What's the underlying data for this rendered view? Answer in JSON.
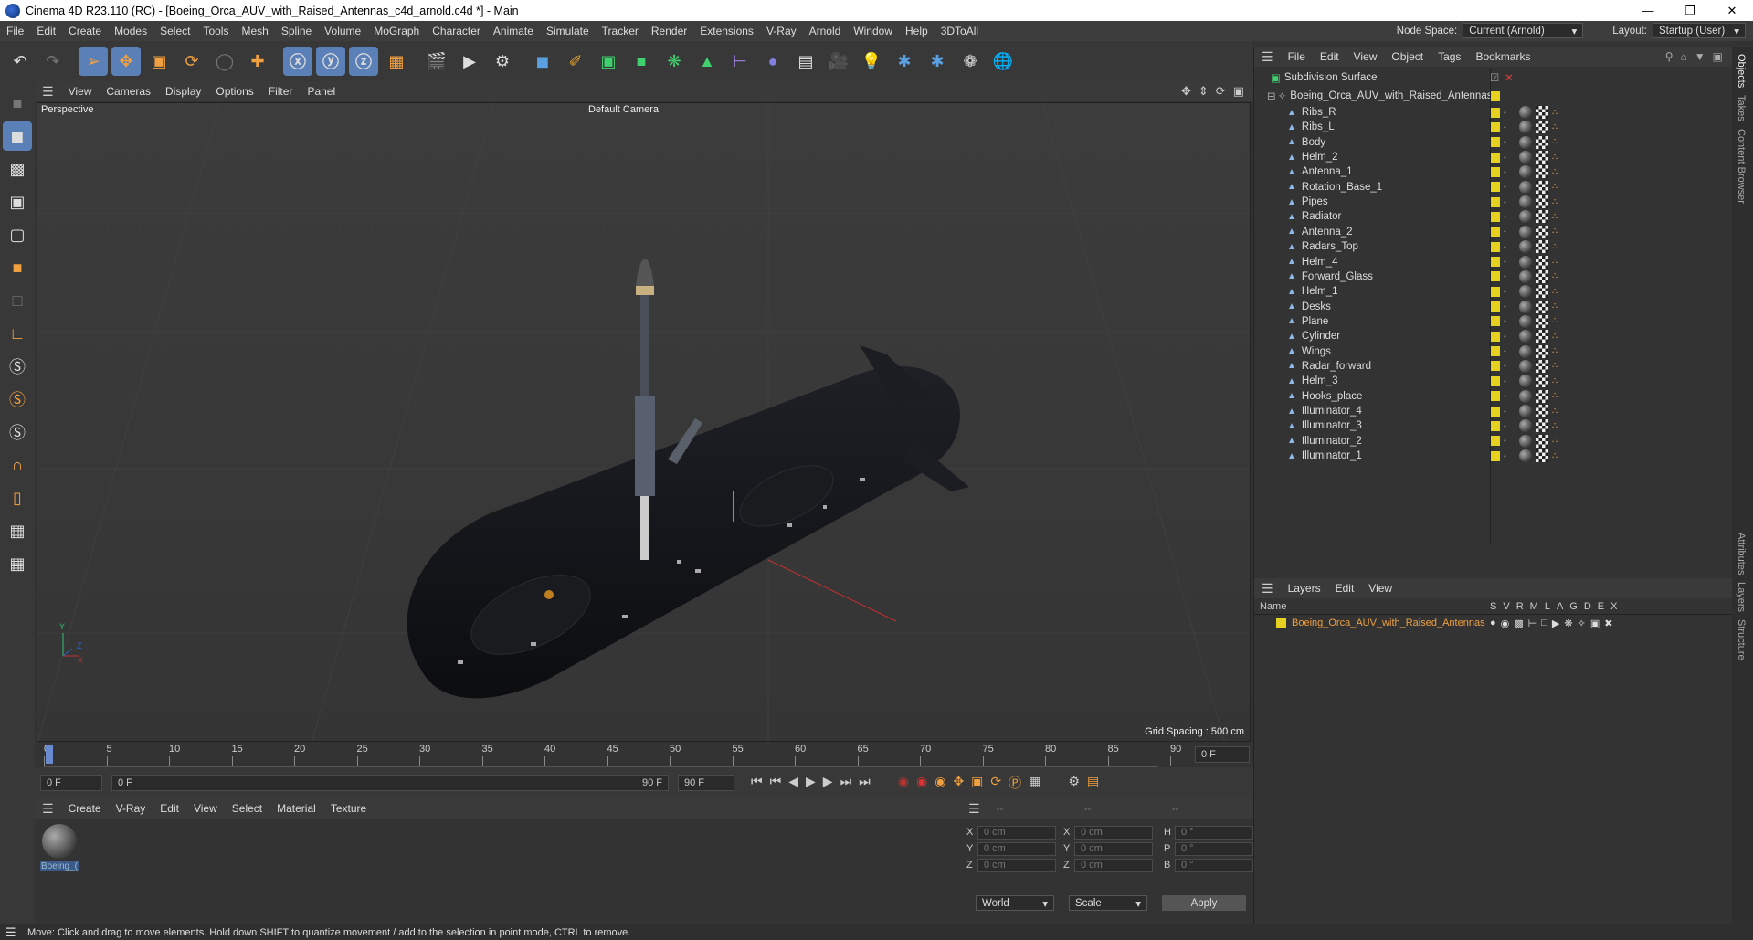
{
  "window": {
    "title": "Cinema 4D R23.110 (RC) - [Boeing_Orca_AUV_with_Raised_Antennas_c4d_arnold.c4d *] - Main"
  },
  "menu": [
    "File",
    "Edit",
    "Create",
    "Modes",
    "Select",
    "Tools",
    "Mesh",
    "Spline",
    "Volume",
    "MoGraph",
    "Character",
    "Animate",
    "Simulate",
    "Tracker",
    "Render",
    "Extensions",
    "V-Ray",
    "Arnold",
    "Window",
    "Help",
    "3DToAll"
  ],
  "nodespace": {
    "label": "Node Space:",
    "value": "Current (Arnold)"
  },
  "layout": {
    "label": "Layout:",
    "value": "Startup (User)"
  },
  "viewport": {
    "menu": [
      "View",
      "Cameras",
      "Display",
      "Options",
      "Filter",
      "Panel"
    ],
    "name": "Perspective",
    "camera": "Default Camera",
    "grid": "Grid Spacing : 500 cm"
  },
  "timeline": {
    "ticks": [
      "0",
      "5",
      "10",
      "15",
      "20",
      "25",
      "30",
      "35",
      "40",
      "45",
      "50",
      "55",
      "60",
      "65",
      "70",
      "75",
      "80",
      "85",
      "90"
    ],
    "current": "0 F"
  },
  "transport": {
    "start": "0 F",
    "range_start": "0 F",
    "range_end": "90 F",
    "end": "90 F"
  },
  "material": {
    "menu": [
      "Create",
      "V-Ray",
      "Edit",
      "View",
      "Select",
      "Material",
      "Texture"
    ],
    "name": "Boeing_("
  },
  "coords": {
    "headers": [
      "--",
      "--",
      "--"
    ],
    "rows": [
      {
        "a": "X",
        "av": "0 cm",
        "b": "X",
        "bv": "0 cm",
        "c": "H",
        "cv": "0 °"
      },
      {
        "a": "Y",
        "av": "0 cm",
        "b": "Y",
        "bv": "0 cm",
        "c": "P",
        "cv": "0 °"
      },
      {
        "a": "Z",
        "av": "0 cm",
        "b": "Z",
        "bv": "0 cm",
        "c": "B",
        "cv": "0 °"
      }
    ],
    "world": "World",
    "scale": "Scale",
    "apply": "Apply"
  },
  "objects": {
    "menu": [
      "File",
      "Edit",
      "View",
      "Object",
      "Tags",
      "Bookmarks"
    ],
    "root": "Subdivision Surface",
    "group": "Boeing_Orca_AUV_with_Raised_Antennas",
    "items": [
      "Ribs_R",
      "Ribs_L",
      "Body",
      "Helm_2",
      "Antenna_1",
      "Rotation_Base_1",
      "Pipes",
      "Radiator",
      "Antenna_2",
      "Radars_Top",
      "Helm_4",
      "Forward_Glass",
      "Helm_1",
      "Desks",
      "Plane",
      "Cylinder",
      "Wings",
      "Radar_forward",
      "Helm_3",
      "Hooks_place",
      "Illuminator_4",
      "Illuminator_3",
      "Illuminator_2",
      "Illuminator_1"
    ]
  },
  "layers": {
    "menu": [
      "Layers",
      "Edit",
      "View"
    ],
    "name_header": "Name",
    "cols": [
      "S",
      "V",
      "R",
      "M",
      "L",
      "A",
      "G",
      "D",
      "E",
      "X"
    ],
    "item": "Boeing_Orca_AUV_with_Raised_Antennas"
  },
  "sidetabs": [
    "Objects",
    "Takes",
    "Content Browser",
    "Attributes",
    "Layers",
    "Structure"
  ],
  "status": "Move: Click and drag to move elements. Hold down SHIFT to quantize movement / add to the selection in point mode, CTRL to remove."
}
